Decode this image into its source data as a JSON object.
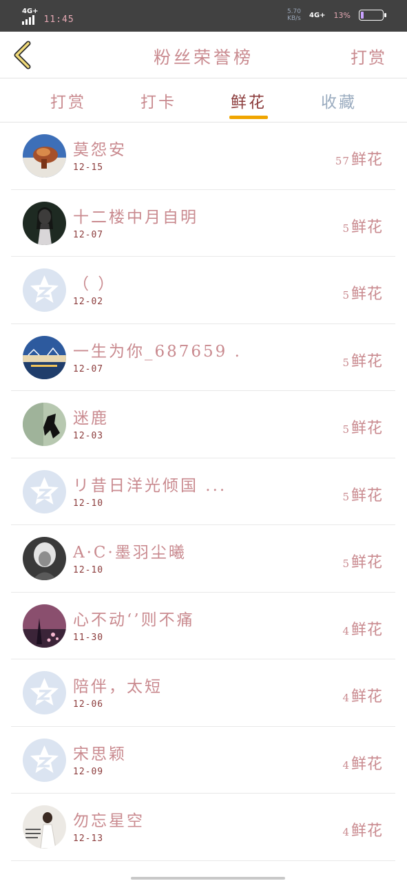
{
  "status_bar": {
    "network_left": "4G+",
    "time": "11:45",
    "speed": "5.70",
    "speed_unit": "KB/s",
    "network_right": "4G+",
    "battery_percent": "13%",
    "battery_level": 0.13
  },
  "header": {
    "back_icon": "chevron-left-icon",
    "title": "粉丝荣誉榜",
    "right_link": "打赏"
  },
  "tabs": [
    {
      "label": "打赏",
      "active": false
    },
    {
      "label": "打卡",
      "active": false
    },
    {
      "label": "鲜花",
      "active": true
    },
    {
      "label": "收藏",
      "active": false
    }
  ],
  "rank_list": [
    {
      "name": "莫怨安",
      "date": "12-15",
      "count": "57",
      "unit": "鲜花",
      "avatar": "photo"
    },
    {
      "name": "十二楼中月自明",
      "date": "12-07",
      "count": "5",
      "unit": "鲜花",
      "avatar": "photo"
    },
    {
      "name": "（ ）",
      "date": "12-02",
      "count": "5",
      "unit": "鲜花",
      "avatar": "default"
    },
    {
      "name": "一生为你_687659 ...",
      "date": "12-07",
      "count": "5",
      "unit": "鲜花",
      "avatar": "photo"
    },
    {
      "name": "迷鹿",
      "date": "12-03",
      "count": "5",
      "unit": "鲜花",
      "avatar": "photo"
    },
    {
      "name": "リ昔日洋光倾国 ...",
      "date": "12-10",
      "count": "5",
      "unit": "鲜花",
      "avatar": "default"
    },
    {
      "name": "A·C·墨羽尘曦",
      "date": "12-10",
      "count": "5",
      "unit": "鲜花",
      "avatar": "photo"
    },
    {
      "name": "心不动‘’则不痛",
      "date": "11-30",
      "count": "4",
      "unit": "鲜花",
      "avatar": "photo"
    },
    {
      "name": "陪伴，太短",
      "date": "12-06",
      "count": "4",
      "unit": "鲜花",
      "avatar": "default"
    },
    {
      "name": "宋思颖",
      "date": "12-09",
      "count": "4",
      "unit": "鲜花",
      "avatar": "default"
    },
    {
      "name": "勿忘星空",
      "date": "12-13",
      "count": "4",
      "unit": "鲜花",
      "avatar": "photo"
    }
  ],
  "colors": {
    "accent": "#f0a500",
    "text_pink": "#c98a8f",
    "text_dark_red": "#8b3b3b",
    "status_bar_bg": "#414141",
    "default_avatar_bg": "#dbe4f1"
  }
}
